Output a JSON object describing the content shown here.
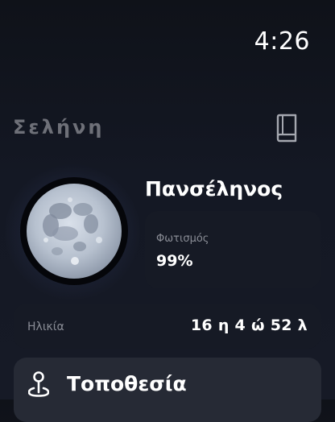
{
  "status": {
    "time": "4:26"
  },
  "header": {
    "title": "Σελήνη",
    "book_icon": "book-icon"
  },
  "moon": {
    "phase_name": "Πανσέληνος",
    "illumination_label": "Φωτισμός",
    "illumination_value": "99%"
  },
  "age": {
    "label": "Ηλικία",
    "value": "16 η 4 ώ 52 λ"
  },
  "location": {
    "title": "Τοποθεσία",
    "icon": "location-pin-icon"
  },
  "colors": {
    "background": "#141824",
    "card": "#161a25",
    "location_card": "#262a35",
    "muted_text": "#8a8d96",
    "title_text": "#6e7078"
  }
}
